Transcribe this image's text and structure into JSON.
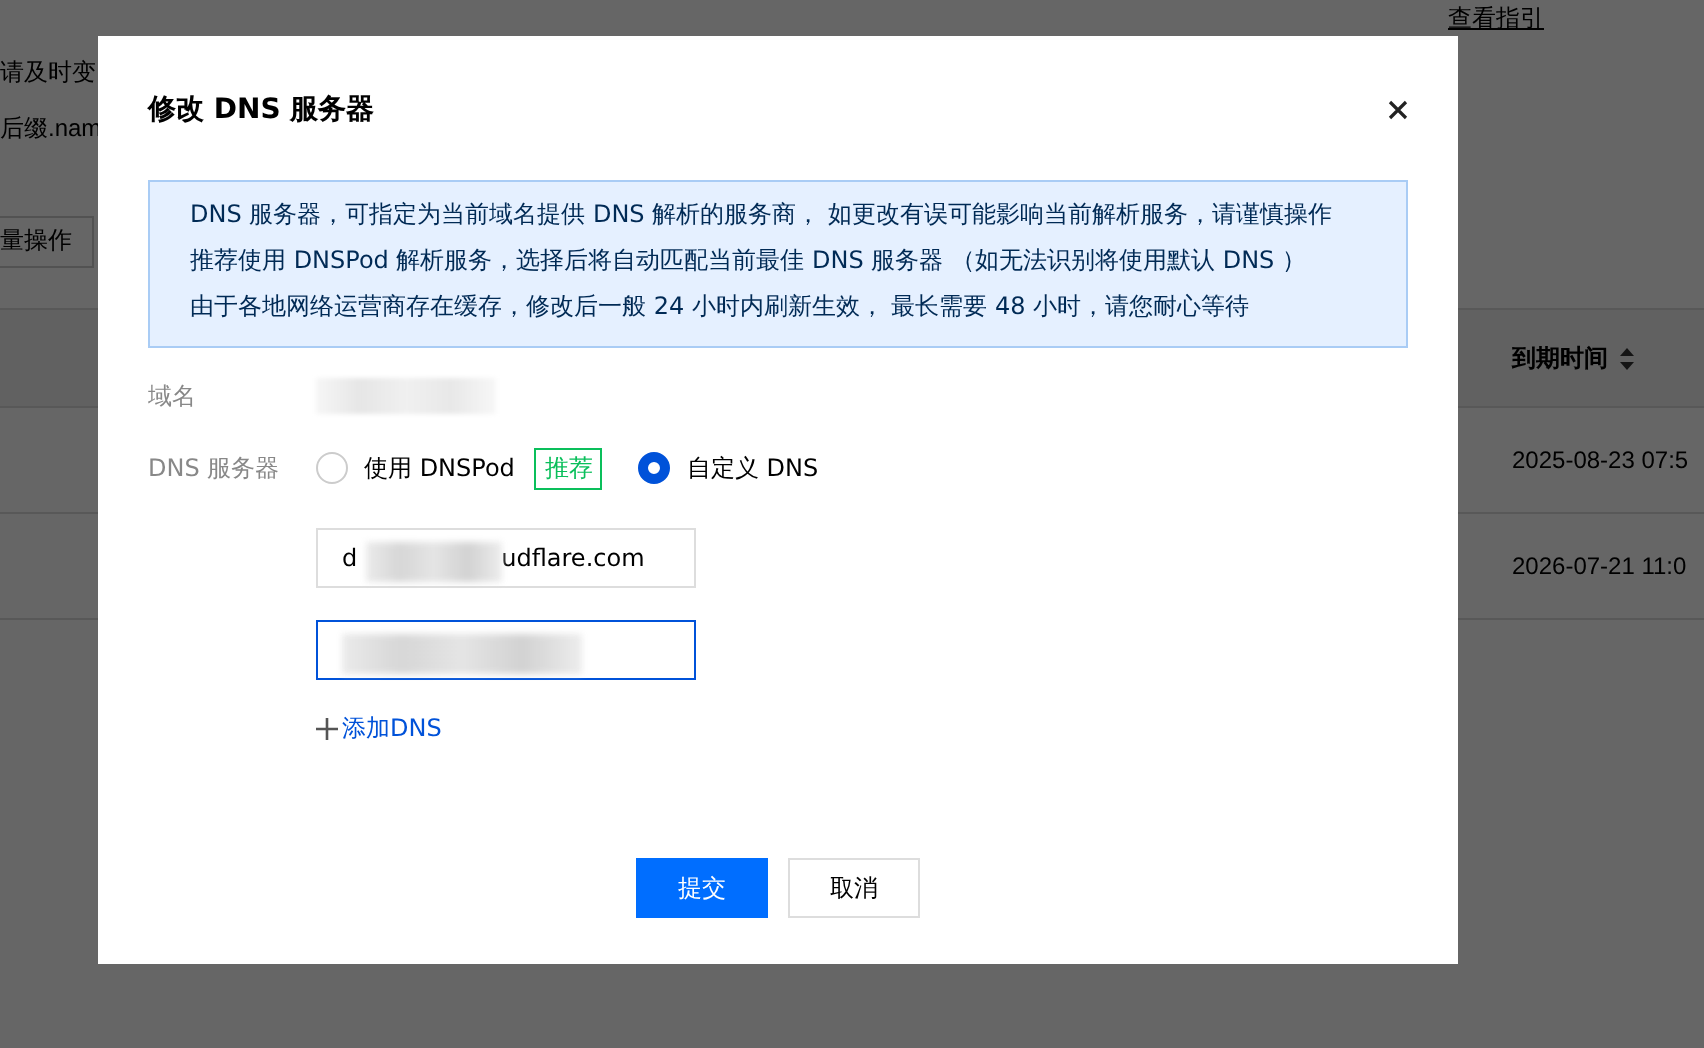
{
  "background": {
    "notice_link": "查看指引",
    "lines": [
      "请及时变",
      "后缀.nam"
    ],
    "batch_button": "量操作",
    "table": {
      "columns": [
        {
          "label": "到期时间",
          "sortable": true
        }
      ],
      "rows": [
        [
          "2025-08-23 07:5"
        ],
        [
          "2026-07-21 11:0"
        ]
      ]
    }
  },
  "dialog": {
    "title": "修改 DNS 服务器",
    "notice": [
      "DNS 服务器，可指定为当前域名提供 DNS 解析的服务商， 如更改有误可能影响当前解析服务，请谨慎操作",
      "推荐使用 DNSPod 解析服务，选择后将自动匹配当前最佳 DNS 服务器 （如无法识别将使用默认 DNS ）",
      "由于各地网络运营商存在缓存，修改后一般 24 小时内刷新生效， 最长需要 48 小时，请您耐心等待"
    ],
    "domain_label": "域名",
    "dns_label": "DNS 服务器",
    "options": [
      {
        "label": "使用 DNSPod",
        "tag": "推荐",
        "selected": false
      },
      {
        "label": "自定义 DNS",
        "selected": true
      }
    ],
    "servers": [
      {
        "start": "d",
        "end": "udflare.com",
        "focused": false
      },
      {
        "focused": true
      }
    ],
    "add_link": "添加DNS",
    "buttons": [
      {
        "label": "提交",
        "kind": "primary"
      },
      {
        "label": "取消",
        "kind": "default"
      }
    ]
  }
}
